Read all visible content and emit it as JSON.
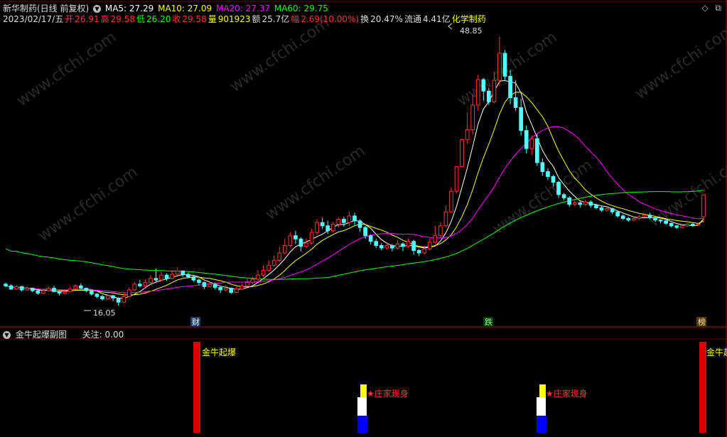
{
  "header": {
    "stock_title": "新华制药(日线 前复权)",
    "ma5": "MA5: 27.29",
    "ma10": "MA10: 27.09",
    "ma20": "MA20: 27.37",
    "ma60": "MA60: 29.75",
    "date": "2023/02/17/五",
    "open_label": "开",
    "open_value": "26.91",
    "high_label": "高",
    "high_value": "29.58",
    "low_label": "低",
    "low_value": "26.20",
    "close_label": "收",
    "close_value": "29.58",
    "volume_label": "量",
    "volume_value": "901923",
    "amount_label": "额",
    "amount_value": "25.7亿",
    "change_label": "幅",
    "change_value": "2.69(10.00%)",
    "turnover_label": "换",
    "turnover_value": "20.47%",
    "float_label": "流通",
    "float_value": "4.41亿",
    "sector": "化学制药"
  },
  "price_labels": {
    "high": "48.85",
    "low": "16.05"
  },
  "event_tags": {
    "cai": "财",
    "die": "跌",
    "bang": "榜"
  },
  "indicator": {
    "title": "金牛起爆副图",
    "focus": "关注: 0.00",
    "signal_label_1": "金牛起爆",
    "signal_label_2": "金牛起",
    "marker_label_1": "★庄家现身",
    "marker_label_2": "★庄家现身"
  },
  "watermark": "www.cfchi.com",
  "colors": {
    "up": "#ff3232",
    "down": "#54ffff",
    "ma5": "#ffffff",
    "ma10": "#ffff00",
    "ma20": "#ff00ff",
    "ma60": "#00ff00",
    "grid": "#b40000"
  },
  "chart_data": {
    "type": "candlestick",
    "title": "新华制药(日线 前复权)",
    "ylim": [
      14.8,
      50
    ],
    "annotations": {
      "max": 48.85,
      "min": 16.05
    },
    "candles": [
      [
        18.7,
        18.5,
        18.9,
        18.3
      ],
      [
        18.5,
        18.1,
        18.7,
        18.0
      ],
      [
        18.1,
        18.4,
        18.6,
        18.0
      ],
      [
        18.4,
        18.0,
        18.5,
        17.8
      ],
      [
        18.0,
        18.2,
        18.4,
        17.9
      ],
      [
        18.2,
        17.9,
        18.3,
        17.7
      ],
      [
        17.9,
        17.6,
        18.0,
        17.4
      ],
      [
        17.6,
        17.9,
        18.1,
        17.5
      ],
      [
        17.9,
        18.2,
        18.4,
        17.8
      ],
      [
        18.2,
        17.8,
        18.5,
        17.7
      ],
      [
        17.8,
        17.6,
        17.9,
        17.3
      ],
      [
        17.6,
        17.8,
        18.0,
        17.5
      ],
      [
        17.8,
        18.1,
        18.4,
        17.7
      ],
      [
        18.1,
        18.5,
        18.7,
        18.0
      ],
      [
        18.5,
        18.2,
        18.8,
        18.1
      ],
      [
        18.2,
        17.9,
        18.3,
        17.7
      ],
      [
        17.9,
        17.5,
        18.0,
        17.3
      ],
      [
        17.5,
        17.2,
        17.6,
        17.0
      ],
      [
        17.2,
        16.9,
        17.4,
        16.7
      ],
      [
        16.9,
        17.3,
        17.5,
        16.8
      ],
      [
        17.3,
        17.0,
        17.4,
        16.6
      ],
      [
        17.0,
        16.5,
        17.1,
        16.05
      ],
      [
        16.5,
        17.2,
        17.6,
        16.4
      ],
      [
        17.2,
        18.0,
        18.3,
        17.1
      ],
      [
        18.0,
        18.7,
        19.0,
        17.9
      ],
      [
        18.7,
        18.5,
        19.2,
        18.3
      ],
      [
        18.5,
        18.9,
        19.3,
        18.4
      ],
      [
        18.9,
        19.4,
        19.8,
        18.8
      ],
      [
        19.4,
        19.2,
        20.6,
        19.0
      ],
      [
        19.2,
        19.8,
        20.4,
        19.0
      ],
      [
        19.8,
        19.4,
        20.0,
        19.1
      ],
      [
        19.4,
        19.9,
        20.3,
        19.3
      ],
      [
        19.9,
        20.3,
        20.8,
        19.7
      ],
      [
        20.3,
        19.9,
        20.4,
        19.6
      ],
      [
        19.9,
        19.6,
        20.1,
        19.4
      ],
      [
        19.6,
        19.2,
        19.8,
        19.0
      ],
      [
        19.2,
        18.9,
        19.4,
        18.6
      ],
      [
        18.9,
        18.4,
        19.0,
        18.1
      ],
      [
        18.4,
        18.7,
        19.0,
        18.3
      ],
      [
        18.7,
        18.3,
        18.9,
        18.1
      ],
      [
        18.3,
        18.0,
        18.4,
        17.6
      ],
      [
        18.0,
        18.2,
        18.6,
        17.8
      ],
      [
        18.2,
        17.7,
        18.3,
        17.5
      ],
      [
        17.7,
        18.1,
        18.4,
        17.6
      ],
      [
        18.1,
        18.5,
        18.8,
        18.0
      ],
      [
        18.5,
        18.9,
        19.4,
        18.4
      ],
      [
        18.9,
        19.3,
        19.6,
        18.7
      ],
      [
        19.3,
        19.8,
        20.4,
        19.1
      ],
      [
        19.8,
        20.4,
        21.0,
        19.6
      ],
      [
        20.4,
        21.0,
        21.6,
        20.2
      ],
      [
        21.0,
        21.6,
        22.2,
        20.8
      ],
      [
        21.6,
        22.5,
        23.2,
        21.4
      ],
      [
        22.5,
        23.4,
        24.2,
        22.3
      ],
      [
        23.4,
        24.6,
        25.0,
        23.2
      ],
      [
        24.6,
        24.2,
        25.2,
        23.6
      ],
      [
        24.2,
        23.3,
        24.4,
        22.7
      ],
      [
        23.3,
        23.7,
        24.3,
        23.1
      ],
      [
        23.7,
        25.0,
        25.4,
        23.5
      ],
      [
        25.0,
        26.2,
        26.6,
        24.7
      ],
      [
        26.2,
        25.8,
        26.8,
        25.4
      ],
      [
        25.8,
        25.2,
        26.4,
        24.8
      ],
      [
        25.2,
        26.0,
        26.3,
        25.0
      ],
      [
        26.0,
        26.6,
        26.8,
        25.6
      ],
      [
        26.6,
        26.2,
        26.9,
        25.7
      ],
      [
        26.2,
        27.0,
        27.5,
        25.8
      ],
      [
        27.0,
        26.4,
        27.4,
        25.9
      ],
      [
        26.4,
        25.6,
        26.6,
        25.1
      ],
      [
        25.6,
        24.6,
        25.8,
        24.2
      ],
      [
        24.6,
        23.9,
        24.8,
        23.5
      ],
      [
        23.9,
        23.4,
        24.2,
        23.1
      ],
      [
        23.4,
        23.1,
        23.7,
        22.8
      ],
      [
        23.1,
        23.4,
        23.8,
        22.9
      ],
      [
        23.4,
        23.1,
        23.6,
        22.7
      ],
      [
        23.1,
        23.6,
        24.1,
        22.9
      ],
      [
        23.6,
        23.3,
        23.8,
        22.7
      ],
      [
        23.3,
        23.9,
        24.3,
        23.1
      ],
      [
        23.9,
        22.8,
        24.1,
        22.3
      ],
      [
        22.8,
        22.5,
        23.0,
        22.1
      ],
      [
        22.5,
        23.0,
        23.4,
        22.3
      ],
      [
        23.0,
        23.8,
        24.2,
        22.8
      ],
      [
        23.8,
        24.6,
        25.8,
        23.6
      ],
      [
        24.6,
        25.8,
        26.2,
        24.4
      ],
      [
        25.8,
        27.5,
        28.2,
        25.6
      ],
      [
        27.5,
        30.0,
        30.5,
        27.4
      ],
      [
        30.0,
        33.0,
        33.0,
        29.8
      ],
      [
        33.0,
        36.3,
        36.3,
        32.9
      ],
      [
        36.3,
        37.5,
        39.6,
        35.8
      ],
      [
        37.5,
        40.5,
        41.8,
        36.9
      ],
      [
        40.5,
        43.6,
        44.2,
        39.8
      ],
      [
        43.6,
        42.2,
        43.8,
        41.0
      ],
      [
        42.2,
        40.9,
        42.6,
        40.5
      ],
      [
        40.9,
        43.5,
        44.6,
        40.7
      ],
      [
        43.5,
        46.8,
        48.85,
        42.8
      ],
      [
        46.8,
        44.0,
        47.2,
        43.4
      ],
      [
        44.0,
        41.4,
        44.8,
        40.6
      ],
      [
        41.4,
        40.2,
        43.5,
        39.8
      ],
      [
        40.2,
        37.4,
        41.3,
        36.8
      ],
      [
        37.4,
        35.2,
        38.0,
        34.6
      ],
      [
        35.2,
        36.4,
        36.8,
        34.4
      ],
      [
        36.4,
        33.5,
        37.0,
        33.1
      ],
      [
        33.5,
        32.4,
        34.0,
        31.9
      ],
      [
        32.4,
        31.8,
        32.8,
        31.4
      ],
      [
        31.8,
        31.1,
        32.0,
        30.6
      ],
      [
        31.1,
        29.6,
        31.3,
        29.2
      ],
      [
        29.6,
        29.2,
        29.8,
        28.9
      ],
      [
        29.2,
        28.4,
        29.4,
        28.1
      ],
      [
        28.4,
        28.6,
        28.9,
        28.2
      ],
      [
        28.6,
        28.4,
        28.8,
        28.0
      ],
      [
        28.4,
        28.7,
        29.0,
        28.2
      ],
      [
        28.7,
        28.3,
        28.9,
        28.0
      ],
      [
        28.3,
        28.0,
        28.5,
        27.8
      ],
      [
        28.0,
        27.7,
        28.2,
        27.5
      ],
      [
        27.7,
        27.9,
        28.1,
        27.5
      ],
      [
        27.9,
        27.5,
        28.0,
        27.2
      ],
      [
        27.5,
        27.0,
        27.6,
        26.8
      ],
      [
        27.0,
        26.7,
        27.2,
        26.5
      ],
      [
        26.7,
        26.5,
        26.9,
        26.3
      ],
      [
        26.5,
        26.7,
        26.9,
        26.4
      ],
      [
        26.7,
        26.9,
        27.1,
        26.5
      ],
      [
        26.9,
        27.1,
        27.3,
        26.8
      ],
      [
        27.1,
        26.8,
        27.4,
        26.6
      ],
      [
        26.8,
        26.5,
        26.9,
        26.3
      ],
      [
        26.5,
        26.4,
        26.6,
        26.1
      ],
      [
        26.4,
        26.1,
        26.5,
        25.9
      ],
      [
        26.1,
        25.8,
        26.2,
        25.6
      ],
      [
        25.8,
        25.6,
        25.9,
        25.4
      ],
      [
        25.6,
        25.8,
        26.0,
        25.5
      ],
      [
        25.8,
        26.0,
        26.1,
        25.7
      ],
      [
        26.0,
        25.9,
        26.2,
        25.7
      ],
      [
        25.9,
        26.0,
        26.2,
        25.8
      ],
      [
        26.91,
        29.58,
        29.58,
        26.2
      ]
    ]
  }
}
